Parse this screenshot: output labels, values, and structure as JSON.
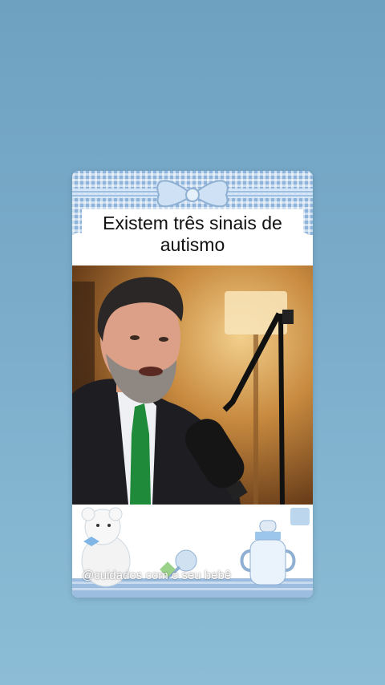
{
  "overlay": {
    "headline_line1": "Existem três sinais de",
    "headline_line2": "autismo",
    "watermark": "@cuidados com o seu bebê"
  },
  "colors": {
    "background_top": "#6ea0c0",
    "background_bottom": "#8cbdd6",
    "frame_blue": "#8fb4dc",
    "tie_green": "#1f8a3a"
  }
}
